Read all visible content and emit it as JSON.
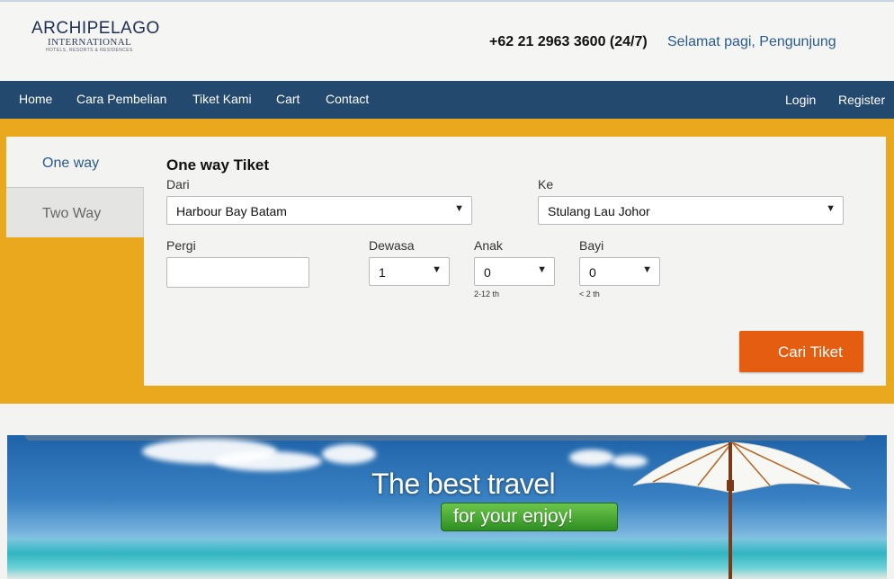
{
  "header": {
    "logo_main": "ARCHIPELAGO",
    "logo_sub": "INTERNATIONAL",
    "logo_tagline": "HOTELS, RESORTS & RESIDENCES",
    "phone": "+62 21 2963 3600 (24/7)",
    "greeting": "Selamat pagi, Pengunjung"
  },
  "nav": {
    "items": [
      "Home",
      "Cara Pembelian",
      "Tiket Kami",
      "Cart",
      "Contact"
    ],
    "login": "Login",
    "register": "Register"
  },
  "tabs": {
    "one_way": "One way",
    "two_way": "Two Way"
  },
  "form": {
    "title": "One way Tiket",
    "dari_label": "Dari",
    "dari_value": "Harbour Bay Batam",
    "ke_label": "Ke",
    "ke_value": "Stulang Lau Johor",
    "pergi_label": "Pergi",
    "pergi_value": "",
    "dewasa_label": "Dewasa",
    "dewasa_value": "1",
    "anak_label": "Anak",
    "anak_value": "0",
    "anak_hint": "2-12 th",
    "bayi_label": "Bayi",
    "bayi_value": "0",
    "bayi_hint": "< 2 th",
    "submit": "Cari Tiket"
  },
  "banner": {
    "headline": "The best travel",
    "subline": "for your enjoy!"
  },
  "colors": {
    "navbar": "#24496f",
    "band": "#e9a81e",
    "button": "#e55d10",
    "link": "#2a5b8e"
  }
}
